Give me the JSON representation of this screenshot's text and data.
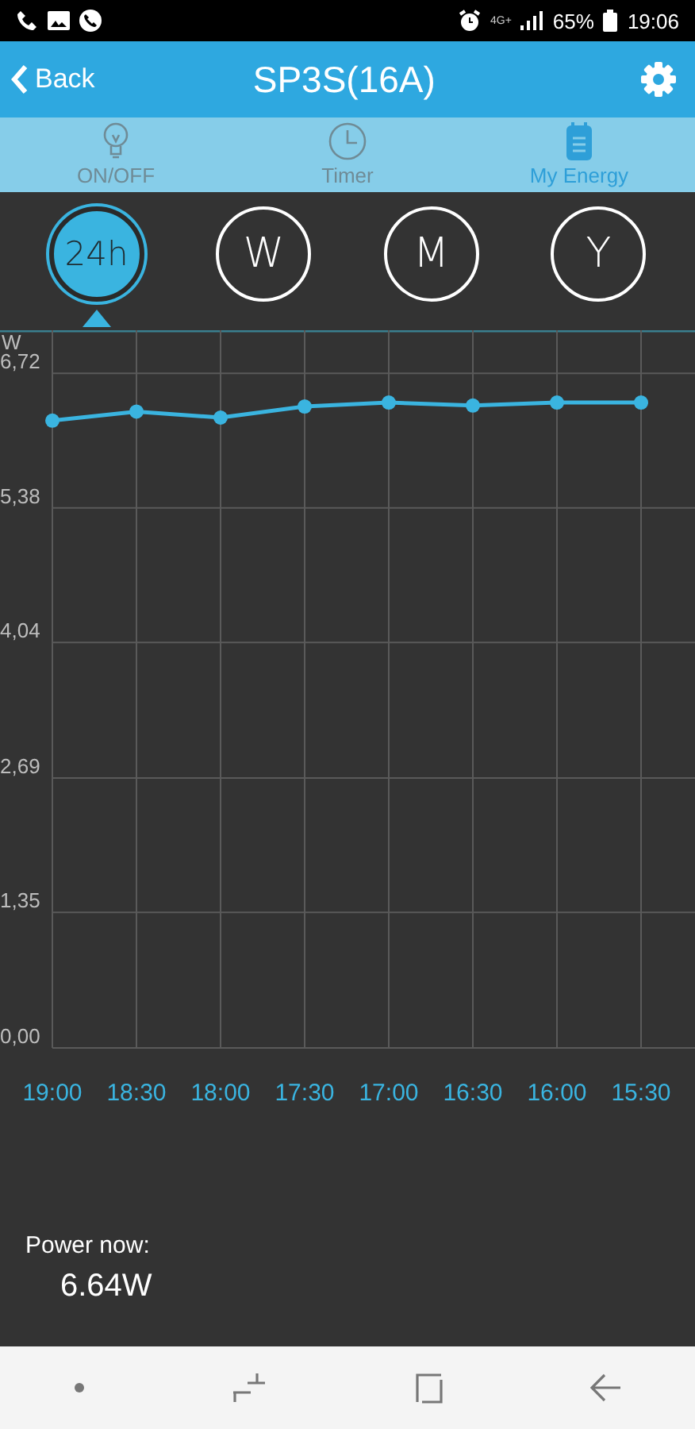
{
  "status_bar": {
    "network": "4G+",
    "battery": "65%",
    "time": "19:06"
  },
  "header": {
    "back": "Back",
    "title": "SP3S(16A)"
  },
  "tabs": [
    {
      "label": "ON/OFF",
      "kind": "bulb",
      "selected": false
    },
    {
      "label": "Timer",
      "kind": "clock",
      "selected": false
    },
    {
      "label": "My Energy",
      "kind": "notepad",
      "selected": true
    }
  ],
  "periods": [
    {
      "label": "24h",
      "selected": true
    },
    {
      "label": "W",
      "selected": false
    },
    {
      "label": "M",
      "selected": false
    },
    {
      "label": "Y",
      "selected": false
    }
  ],
  "chart": {
    "chart_data": {
      "type": "line",
      "ylabel": "W",
      "categories": [
        "19:00",
        "18:30",
        "18:00",
        "17:30",
        "17:00",
        "16:30",
        "16:00",
        "15:30"
      ],
      "grid": true,
      "series": [
        {
          "color": "#3ab4e0",
          "marker": true,
          "values": [
            6.25,
            6.34,
            6.28,
            6.39,
            6.43,
            6.4,
            6.43,
            6.43
          ]
        }
      ],
      "ylim": [
        0,
        7.15
      ],
      "yticks": [
        {
          "value": 0,
          "label": "0,00"
        },
        {
          "value": 1.35,
          "label": "1,35"
        },
        {
          "value": 2.69,
          "label": "2,69"
        },
        {
          "value": 4.04,
          "label": "4,04"
        },
        {
          "value": 5.38,
          "label": "5,38"
        },
        {
          "value": 6.72,
          "label": "6,72"
        }
      ]
    }
  },
  "power": {
    "label": "Power now:",
    "value": "6.64W"
  }
}
